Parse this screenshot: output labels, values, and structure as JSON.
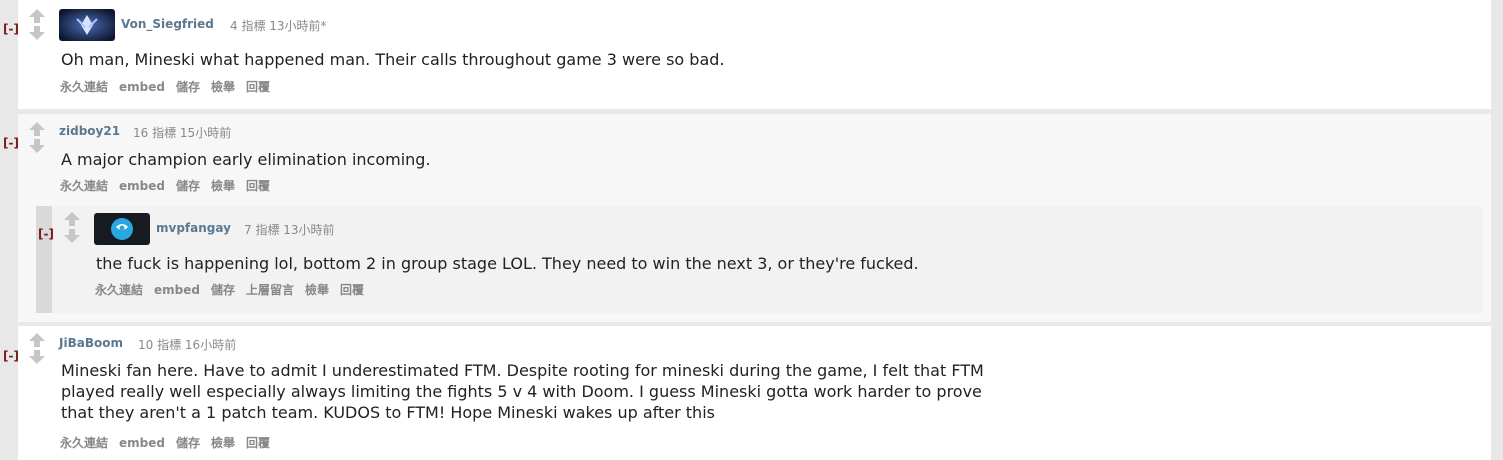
{
  "collapse_label": "[-]",
  "comments": [
    {
      "author": "Von_Siegfried",
      "points": "4 指標",
      "time": "13小時前*",
      "body": "Oh man, Mineski what happened man. Their calls throughout game 3 were so bad.",
      "actions": [
        "永久連結",
        "embed",
        "儲存",
        "檢舉",
        "回覆"
      ]
    },
    {
      "author": "zidboy21",
      "points": "16 指標",
      "time": "15小時前",
      "body": "A major champion early elimination incoming.",
      "actions": [
        "永久連結",
        "embed",
        "儲存",
        "檢舉",
        "回覆"
      ],
      "reply": {
        "author": "mvpfangay",
        "points": "7 指標",
        "time": "13小時前",
        "body": "the fuck is happening lol, bottom 2 in group stage LOL. They need to win the next 3, or they're fucked.",
        "actions": [
          "永久連結",
          "embed",
          "儲存",
          "上層留言",
          "檢舉",
          "回覆"
        ]
      }
    },
    {
      "author": "JiBaBoom",
      "points": "10 指標",
      "time": "16小時前",
      "body_lines": [
        "Mineski fan here. Have to admit I underestimated FTM. Despite rooting for mineski during the game, I felt that FTM",
        "played really well especially always limiting the fights 5 v 4 with Doom. I guess Mineski gotta work harder to prove",
        "that they aren't a 1 patch team. KUDOS to FTM! Hope Mineski wakes up after this"
      ],
      "actions": [
        "永久連結",
        "embed",
        "儲存",
        "檢舉",
        "回覆"
      ]
    }
  ],
  "icons": {
    "upvote": "upvote-arrow-icon",
    "downvote": "downvote-arrow-icon"
  },
  "colors": {
    "author": "#5b7891",
    "collapse": "#7b1b1b",
    "meta": "#888888"
  }
}
